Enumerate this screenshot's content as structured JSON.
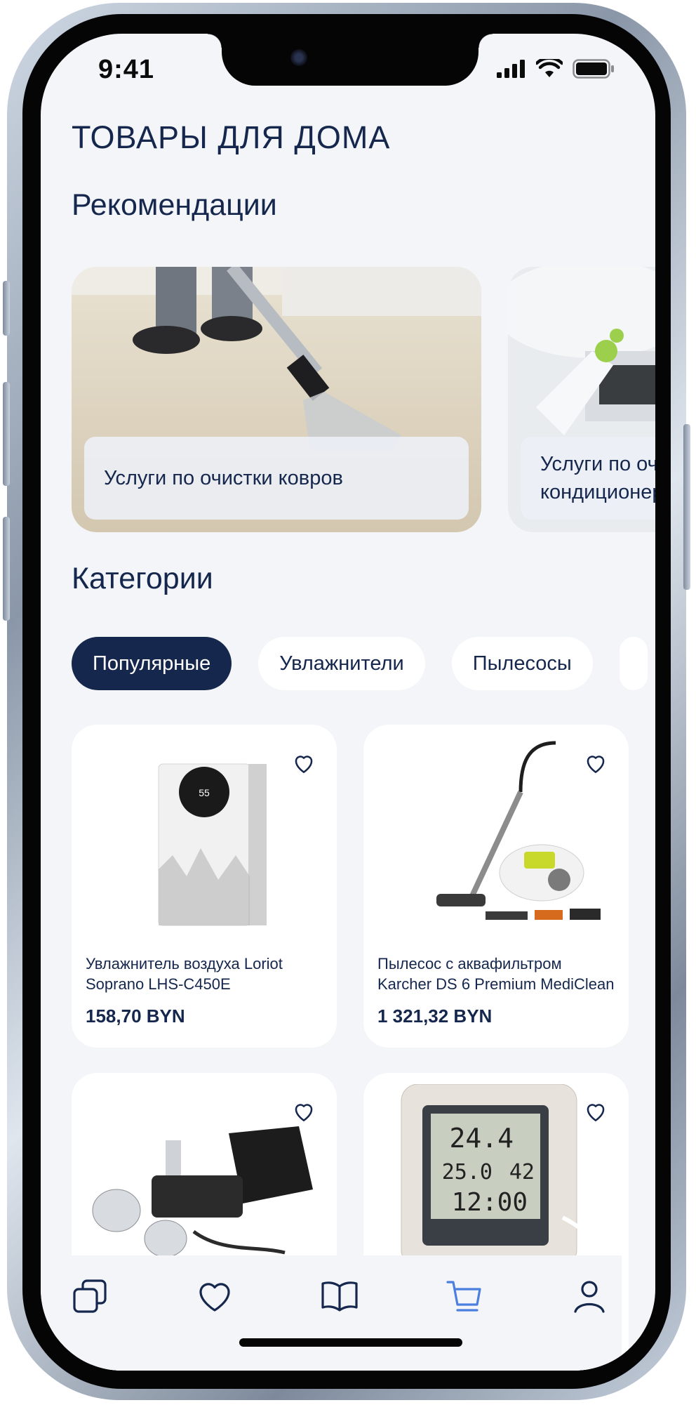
{
  "status_bar": {
    "time": "9:41"
  },
  "page": {
    "title": "ТОВАРЫ ДЛЯ ДОМА"
  },
  "recommendations": {
    "title": "Рекомендации",
    "items": [
      {
        "label": "Услуги по очистки ковров"
      },
      {
        "label": "Услуги по очистке кондиционеров"
      }
    ]
  },
  "categories": {
    "title": "Категории",
    "chips": [
      {
        "label": "Популярные",
        "active": true
      },
      {
        "label": "Увлажнители",
        "active": false
      },
      {
        "label": "Пылесосы",
        "active": false
      }
    ]
  },
  "products": [
    {
      "name": "Увлажнитель воздуха Loriot Soprano LHS-C450E",
      "price": "158,70 BYN"
    },
    {
      "name": "Пылесос с аквафильтром Karcher DS 6 Premium MediClean",
      "price": "1 321,32 BYN"
    },
    {
      "name": "",
      "price": ""
    },
    {
      "name": "",
      "price": ""
    }
  ],
  "tabbar": {
    "items": [
      "catalog-icon",
      "heart-icon",
      "book-icon",
      "cart-icon",
      "user-icon"
    ],
    "active": "cart-icon"
  },
  "colors": {
    "primary": "#15274d",
    "background": "#f4f5f9",
    "accent": "#4a7fe0"
  }
}
